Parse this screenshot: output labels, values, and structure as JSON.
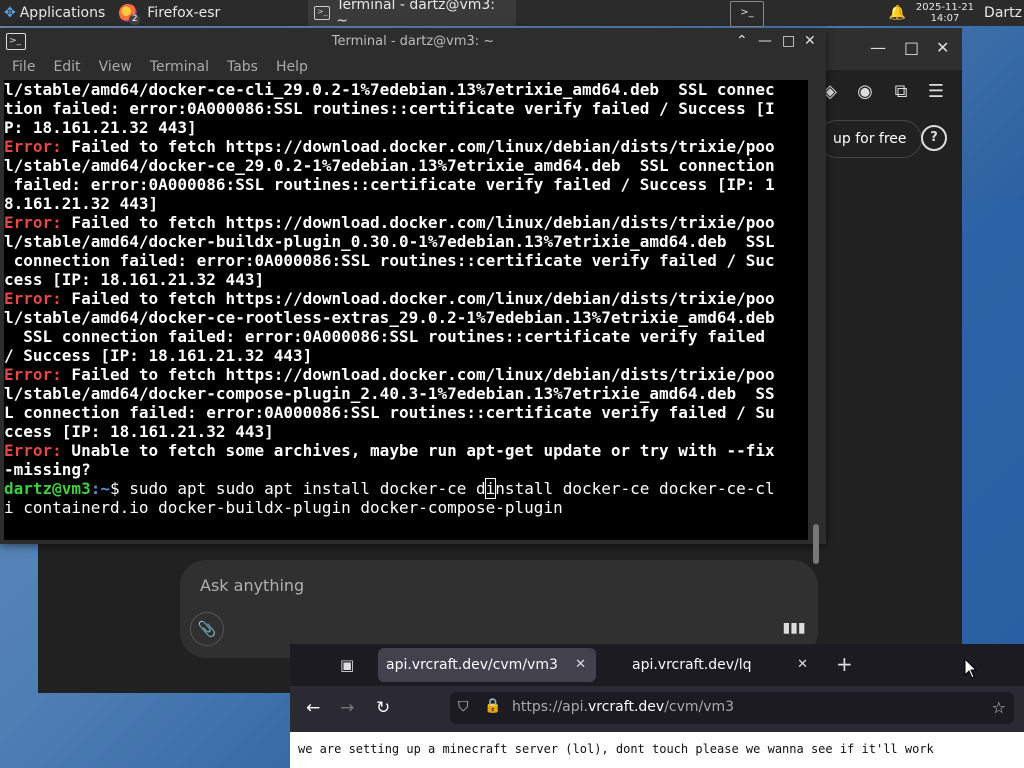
{
  "panel": {
    "applications_label": "Applications",
    "tasks": [
      {
        "label": "Firefox-esr",
        "badge": "2"
      },
      {
        "label": "Terminal - dartz@vm3: ~"
      }
    ],
    "clock_date": "2025-11-21",
    "clock_time": "14:07",
    "user": "Dartz"
  },
  "chat": {
    "signup_label": "up for free",
    "help_label": "?",
    "ask_placeholder": "Ask anything"
  },
  "terminal": {
    "title": "Terminal - dartz@vm3: ~",
    "menu": [
      "File",
      "Edit",
      "View",
      "Terminal",
      "Tabs",
      "Help"
    ],
    "lines": [
      {
        "prefix": "",
        "text": "l/stable/amd64/docker-ce-cli_29.0.2-1%7edebian.13%7etrixie_amd64.deb  SSL connec"
      },
      {
        "prefix": "",
        "text": "tion failed: error:0A000086:SSL routines::certificate verify failed / Success [I"
      },
      {
        "prefix": "",
        "text": "P: 18.161.21.32 443]"
      },
      {
        "prefix": "Error:",
        "text": " Failed to fetch https://download.docker.com/linux/debian/dists/trixie/poo"
      },
      {
        "prefix": "",
        "text": "l/stable/amd64/docker-ce_29.0.2-1%7edebian.13%7etrixie_amd64.deb  SSL connection"
      },
      {
        "prefix": "",
        "text": " failed: error:0A000086:SSL routines::certificate verify failed / Success [IP: 1"
      },
      {
        "prefix": "",
        "text": "8.161.21.32 443]"
      },
      {
        "prefix": "Error:",
        "text": " Failed to fetch https://download.docker.com/linux/debian/dists/trixie/poo"
      },
      {
        "prefix": "",
        "text": "l/stable/amd64/docker-buildx-plugin_0.30.0-1%7edebian.13%7etrixie_amd64.deb  SSL"
      },
      {
        "prefix": "",
        "text": " connection failed: error:0A000086:SSL routines::certificate verify failed / Suc"
      },
      {
        "prefix": "",
        "text": "cess [IP: 18.161.21.32 443]"
      },
      {
        "prefix": "Error:",
        "text": " Failed to fetch https://download.docker.com/linux/debian/dists/trixie/poo"
      },
      {
        "prefix": "",
        "text": "l/stable/amd64/docker-ce-rootless-extras_29.0.2-1%7edebian.13%7etrixie_amd64.deb"
      },
      {
        "prefix": "",
        "text": "  SSL connection failed: error:0A000086:SSL routines::certificate verify failed"
      },
      {
        "prefix": "",
        "text": "/ Success [IP: 18.161.21.32 443]"
      },
      {
        "prefix": "Error:",
        "text": " Failed to fetch https://download.docker.com/linux/debian/dists/trixie/poo"
      },
      {
        "prefix": "",
        "text": "l/stable/amd64/docker-compose-plugin_2.40.3-1%7edebian.13%7etrixie_amd64.deb  SS"
      },
      {
        "prefix": "",
        "text": "L connection failed: error:0A000086:SSL routines::certificate verify failed / Su"
      },
      {
        "prefix": "",
        "text": "ccess [IP: 18.161.21.32 443]"
      },
      {
        "prefix": "Error:",
        "text": " Unable to fetch some archives, maybe run apt-get update or try with --fix"
      },
      {
        "prefix": "",
        "text": "-missing?"
      }
    ],
    "prompt_user": "dartz@vm3",
    "prompt_path": ":~",
    "prompt_sym": "$ ",
    "command_before_cursor": "sudo apt sudo apt install docker-ce d",
    "cursor_char": "i",
    "command_after_cursor": "nstall docker-ce docker-ce-cl",
    "command_wrap": "i containerd.io docker-buildx-plugin docker-compose-plugin"
  },
  "firefox": {
    "tabs": [
      {
        "label": "api.vrcraft.dev/cvm/vm3",
        "active": true
      },
      {
        "label": "api.vrcraft.dev/lq",
        "active": false
      }
    ],
    "url_prefix": "https://api.",
    "url_domain": "vrcraft.dev",
    "url_path": "/cvm/vm3",
    "page_text": "we are setting up a minecraft server (lol), dont touch please we wanna see if it'll work"
  }
}
